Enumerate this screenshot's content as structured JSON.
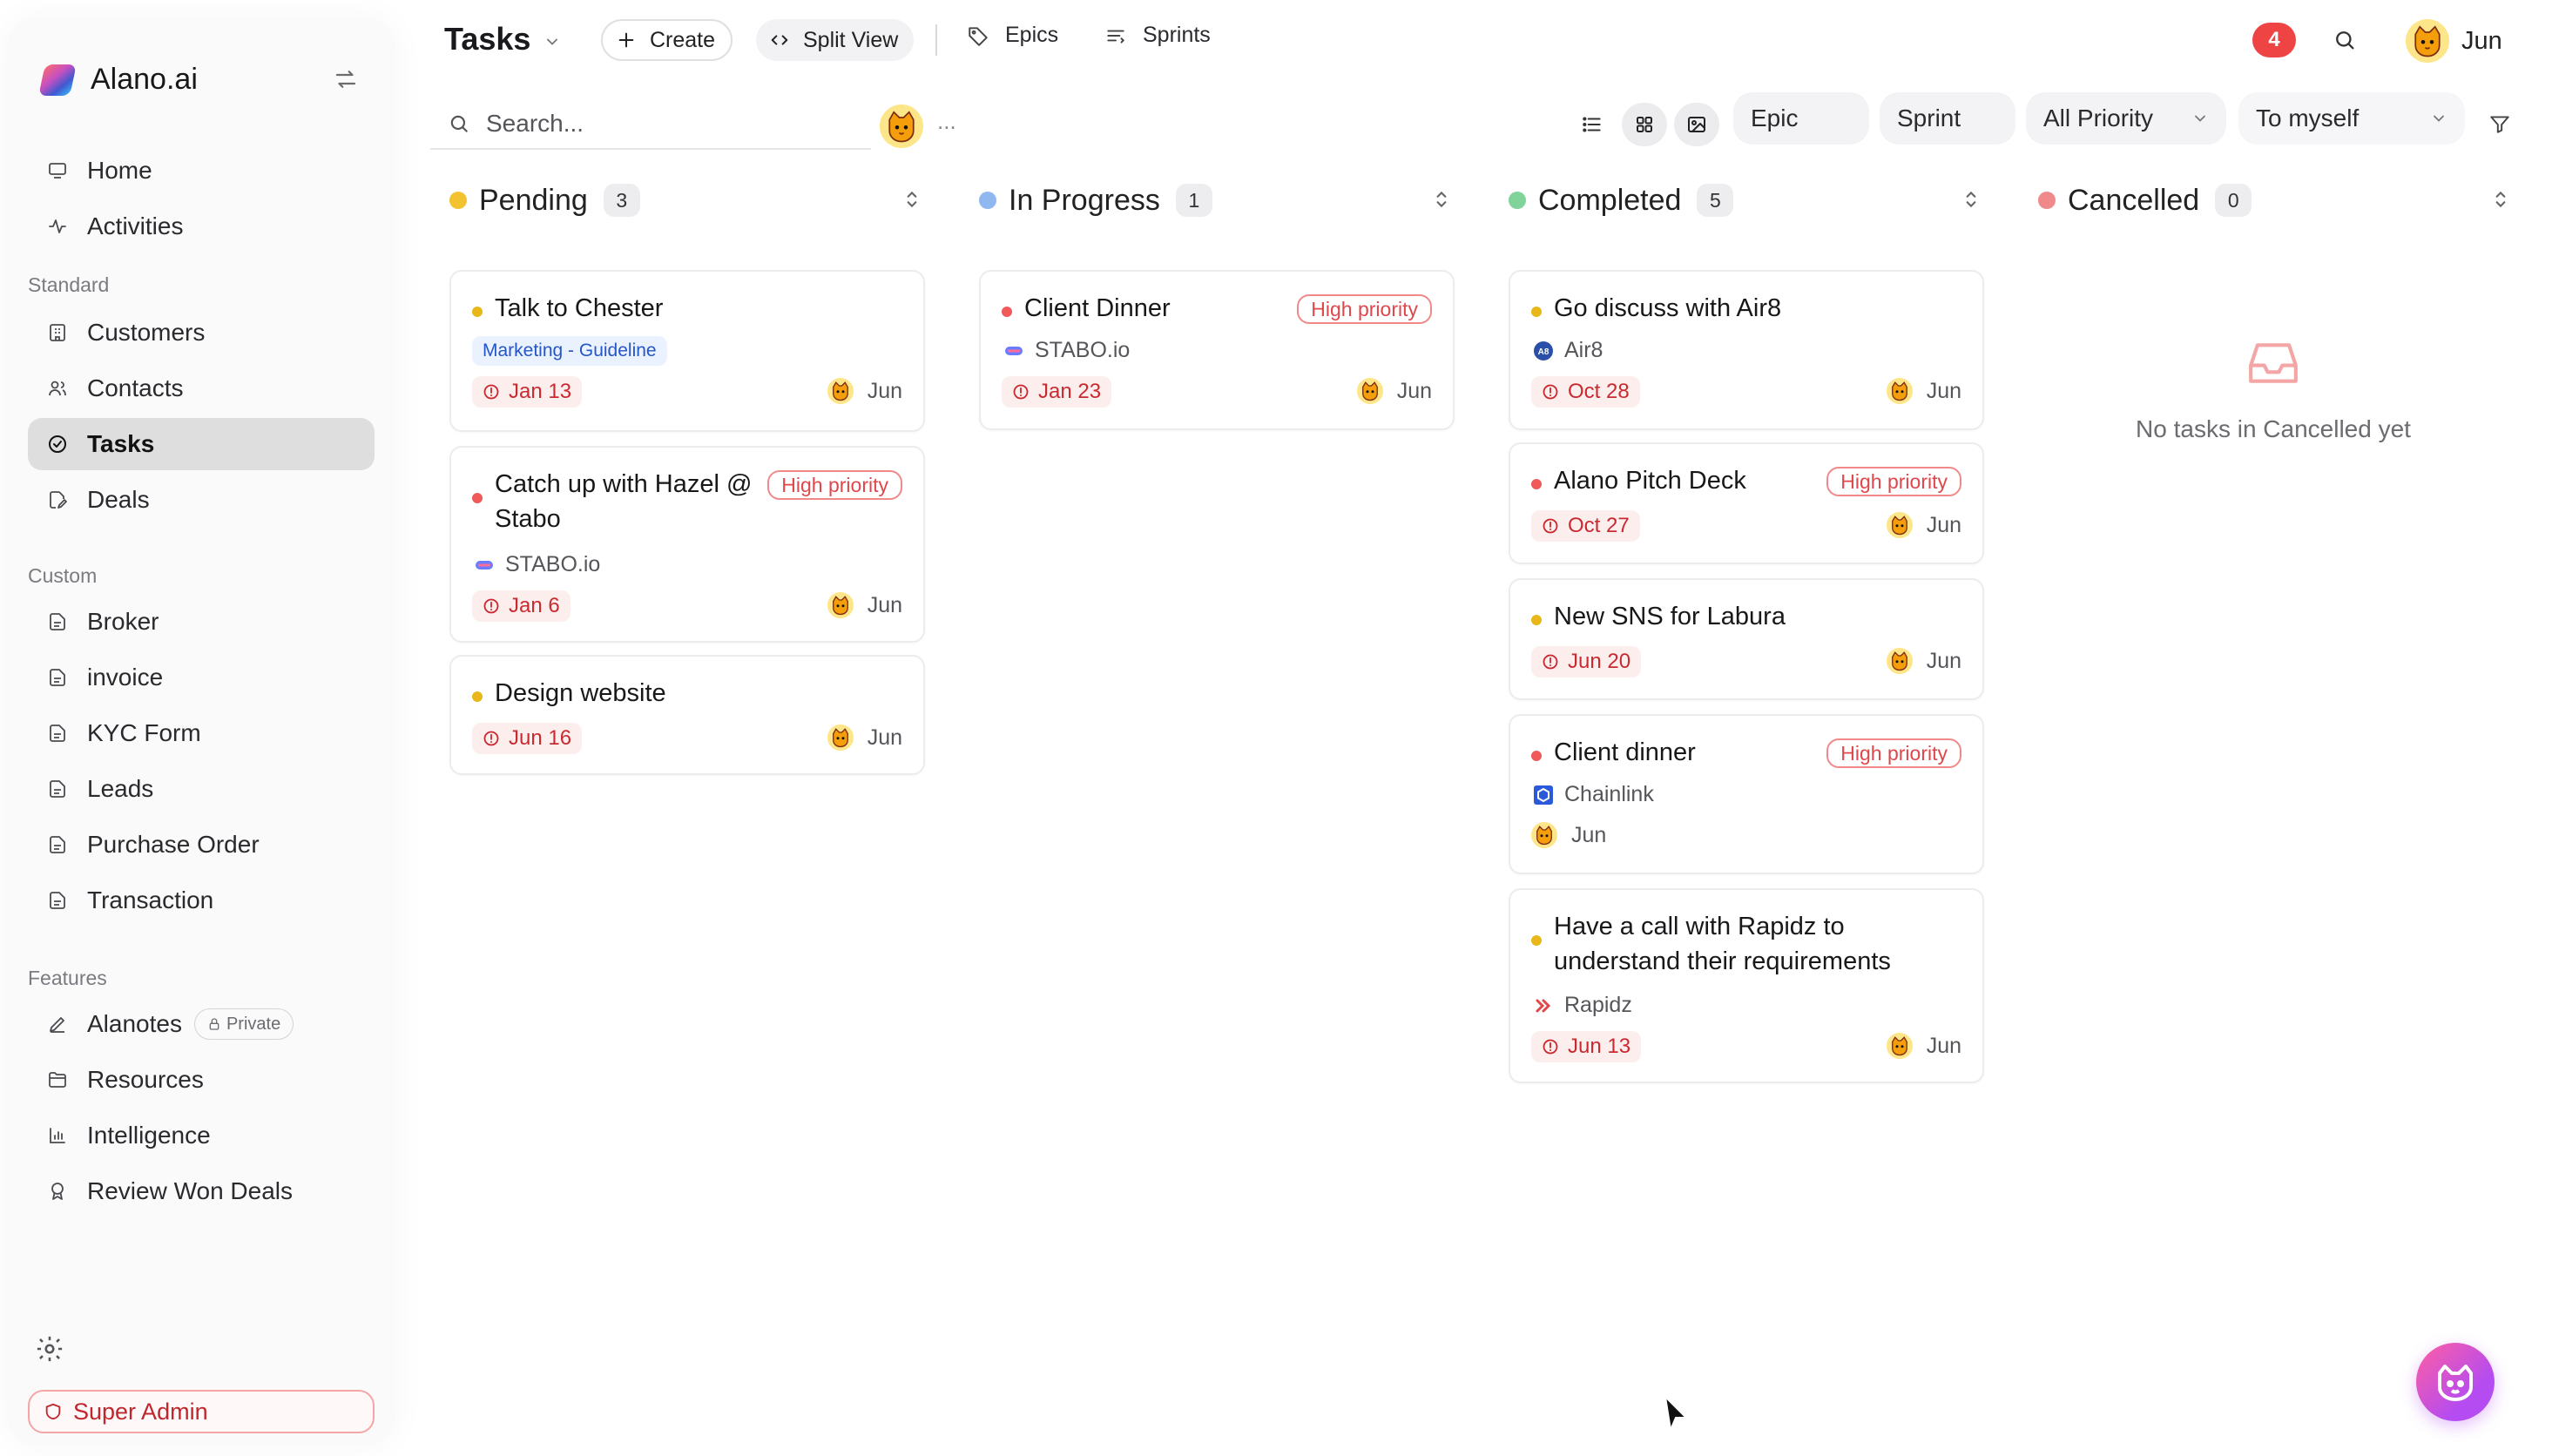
{
  "brand": {
    "name": "Alano.ai"
  },
  "sidebar": {
    "top_items": [
      {
        "label": "Home",
        "icon": "monitor-icon"
      },
      {
        "label": "Activities",
        "icon": "activity-icon"
      }
    ],
    "standard_title": "Standard",
    "standard_items": [
      {
        "label": "Customers",
        "icon": "building-icon"
      },
      {
        "label": "Contacts",
        "icon": "users-icon"
      },
      {
        "label": "Tasks",
        "icon": "check-circle-icon",
        "active": true
      },
      {
        "label": "Deals",
        "icon": "edit-doc-icon"
      }
    ],
    "custom_title": "Custom",
    "custom_items": [
      {
        "label": "Broker"
      },
      {
        "label": "invoice"
      },
      {
        "label": "KYC Form"
      },
      {
        "label": "Leads"
      },
      {
        "label": "Purchase Order"
      },
      {
        "label": "Transaction"
      }
    ],
    "features_title": "Features",
    "feature_items": [
      {
        "label": "Alanotes",
        "badge": "Private"
      },
      {
        "label": "Resources"
      },
      {
        "label": "Intelligence"
      },
      {
        "label": "Review Won Deals"
      }
    ],
    "super_admin": "Super Admin"
  },
  "topbar": {
    "title": "Tasks",
    "create": "Create",
    "split_view": "Split View",
    "epics": "Epics",
    "sprints": "Sprints",
    "notifications": "4",
    "user": "Jun"
  },
  "filters": {
    "search_placeholder": "Search...",
    "more": "...",
    "epic": "Epic",
    "sprint": "Sprint",
    "priority": "All Priority",
    "assignee": "To myself"
  },
  "colors": {
    "pending": "#f2c230",
    "in_progress": "#8fb8f0",
    "completed": "#7fd39b",
    "cancelled": "#f08a8a",
    "high_priority": "#e0474b",
    "due_bg": "#fdeeee"
  },
  "columns": [
    {
      "title": "Pending",
      "count": "3",
      "cards": [
        {
          "title": "Talk to Chester",
          "tag": "Marketing - Guideline",
          "due": "Jan 13",
          "assignee": "Jun",
          "dot": "#e8b71a"
        },
        {
          "title": "Catch up with Hazel @ Stabo",
          "priority": "High priority",
          "company": "STABO.io",
          "due": "Jan 6",
          "assignee": "Jun",
          "dot": "#ef5a5a"
        },
        {
          "title": "Design website",
          "due": "Jun 16",
          "assignee": "Jun",
          "dot": "#e8b71a"
        }
      ]
    },
    {
      "title": "In Progress",
      "count": "1",
      "cards": [
        {
          "title": "Client Dinner",
          "priority": "High priority",
          "company": "STABO.io",
          "due": "Jan 23",
          "assignee": "Jun",
          "dot": "#ef5a5a"
        }
      ]
    },
    {
      "title": "Completed",
      "count": "5",
      "cards": [
        {
          "title": "Go discuss with Air8",
          "company": "Air8",
          "due": "Oct 28",
          "assignee": "Jun",
          "dot": "#e8b71a"
        },
        {
          "title": "Alano Pitch Deck",
          "priority": "High priority",
          "due": "Oct 27",
          "assignee": "Jun",
          "dot": "#ef5a5a"
        },
        {
          "title": "New SNS for Labura",
          "due": "Jun 20",
          "assignee": "Jun",
          "dot": "#e8b71a"
        },
        {
          "title": "Client dinner",
          "priority": "High priority",
          "company": "Chainlink",
          "assignee": "Jun",
          "dot": "#ef5a5a"
        },
        {
          "title": "Have a call with Rapidz to understand their requirements",
          "company": "Rapidz",
          "due": "Jun 13",
          "assignee": "Jun",
          "dot": "#e8b71a"
        }
      ]
    },
    {
      "title": "Cancelled",
      "count": "0",
      "empty_text": "No tasks in Cancelled yet"
    }
  ]
}
